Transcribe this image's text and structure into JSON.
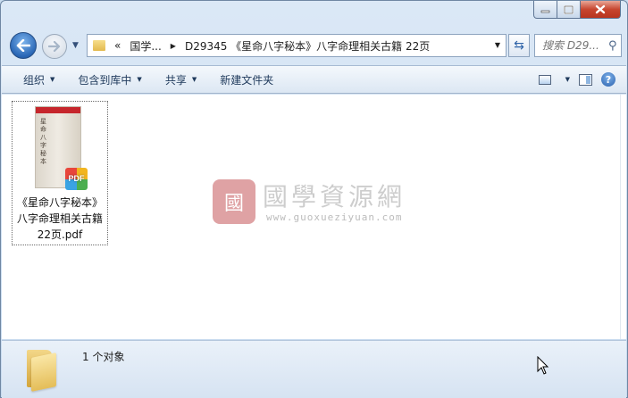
{
  "window": {
    "caption_buttons": [
      {
        "name": "minimize",
        "glyph": "▭"
      },
      {
        "name": "maximize",
        "glyph": "▢"
      },
      {
        "name": "close",
        "glyph": "✕"
      }
    ]
  },
  "address": {
    "overflow": "«",
    "crumbs": [
      "国学...",
      "D29345 《星命八字秘本》八字命理相关古籍 22页"
    ],
    "search_placeholder": "搜索 D29..."
  },
  "toolbar": {
    "organize": "组织",
    "include_in_library": "包含到库中",
    "share": "共享",
    "new_folder": "新建文件夹",
    "help": "?"
  },
  "files": [
    {
      "name_line1": "《星命八字秘本》",
      "name_line2": "八字命理相关古籍",
      "name_line3": "22页.pdf",
      "badge": "PDF",
      "thumb_text": "星命八字秘本"
    }
  ],
  "watermark": {
    "seal": "國",
    "title": "國學資源網",
    "url": "www.guoxueziyuan.com"
  },
  "status": {
    "count_text": "1 个对象"
  },
  "colors": {
    "accent": "#2a67b6",
    "close_button": "#c7462f",
    "pdf_badge": [
      "#e8463c",
      "#f2b51f",
      "#3aa3e3",
      "#4caf50"
    ]
  }
}
